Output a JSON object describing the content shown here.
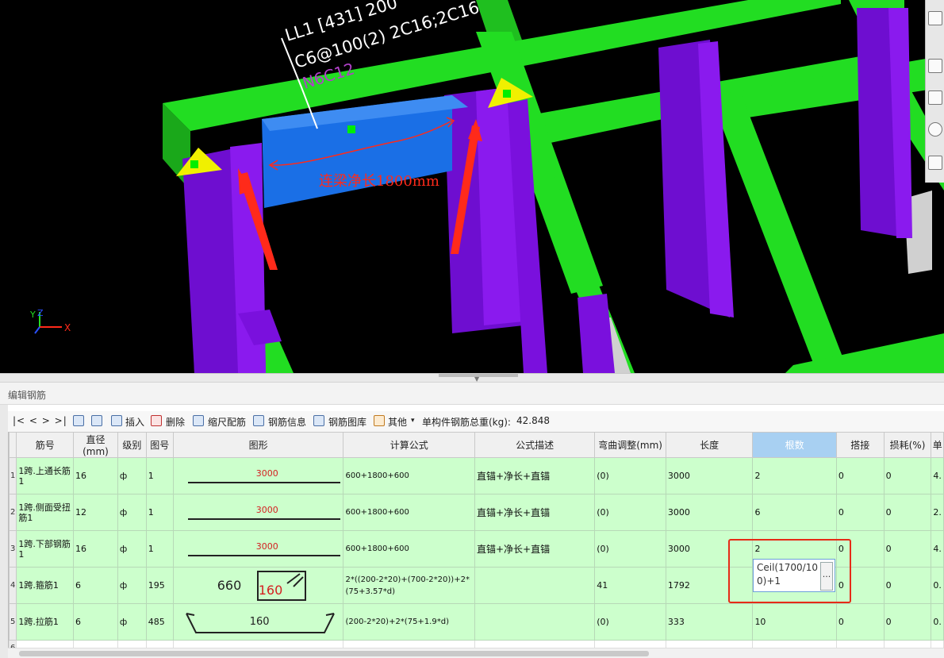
{
  "viewport": {
    "beam_label": {
      "line1": "LL1 [431] 200 *",
      "line2": "C6@100(2) 2C16;2C16",
      "line3": "N6C12"
    },
    "annotation": "连梁净长1800mm",
    "axes": {
      "x": "X",
      "y": "Y",
      "z": "Z"
    },
    "colors": {
      "beam": "#22dd22",
      "column": "#7a10dd",
      "selected": "#1a6fe6",
      "arrow": "#ff2a1a",
      "marker": "#f0f000",
      "annotation": "#ff2a1a"
    }
  },
  "panel": {
    "title": "编辑钢筋"
  },
  "toolbar": {
    "nav": "|<  <  >  >|",
    "insert": "插入",
    "delete": "删除",
    "scale_rebar": "缩尺配筋",
    "rebar_info": "钢筋信息",
    "rebar_library": "钢筋图库",
    "other": "其他",
    "total_weight_label": "单构件钢筋总重(kg):",
    "total_weight_value": "42.848"
  },
  "table": {
    "columns": [
      "筋号",
      "直径(mm)",
      "级别",
      "图号",
      "图形",
      "计算公式",
      "公式描述",
      "弯曲调整(mm)",
      "长度",
      "根数",
      "搭接",
      "损耗(%)",
      "单"
    ],
    "rows": [
      {
        "idx": "1",
        "name": "1跨.上通长筋1",
        "dia": "16",
        "grade": "ф",
        "fig": "1",
        "shape": "3000",
        "formula": "600+1800+600",
        "desc": "直锚+净长+直锚",
        "bend": "(0)",
        "length": "3000",
        "count": "2",
        "lap": "0",
        "loss": "0",
        "unit": "4."
      },
      {
        "idx": "2",
        "name": "1跨.侧面受扭筋1",
        "dia": "12",
        "grade": "ф",
        "fig": "1",
        "shape": "3000",
        "formula": "600+1800+600",
        "desc": "直锚+净长+直锚",
        "bend": "(0)",
        "length": "3000",
        "count": "6",
        "lap": "0",
        "loss": "0",
        "unit": "2."
      },
      {
        "idx": "3",
        "name": "1跨.下部钢筋1",
        "dia": "16",
        "grade": "ф",
        "fig": "1",
        "shape": "3000",
        "formula": "600+1800+600",
        "desc": "直锚+净长+直锚",
        "bend": "(0)",
        "length": "3000",
        "count": "2",
        "lap": "0",
        "loss": "0",
        "unit": "4."
      },
      {
        "idx": "4",
        "name": "1跨.箍筋1",
        "dia": "6",
        "grade": "ф",
        "fig": "195",
        "shape_a": "660",
        "shape_b": "160",
        "formula": "2*((200-2*20)+(700-2*20))+2*(75+3.57*d)",
        "desc": "",
        "bend": "41",
        "length": "1792",
        "count": "Ceil(1700/100)+1",
        "lap": "0",
        "loss": "0",
        "unit": "0."
      },
      {
        "idx": "5",
        "name": "1跨.拉筋1",
        "dia": "6",
        "grade": "ф",
        "fig": "485",
        "shape": "160",
        "formula": "(200-2*20)+2*(75+1.9*d)",
        "desc": "",
        "bend": "(0)",
        "length": "333",
        "count": "10",
        "lap": "0",
        "loss": "0",
        "unit": "0."
      },
      {
        "idx": "6"
      }
    ]
  }
}
